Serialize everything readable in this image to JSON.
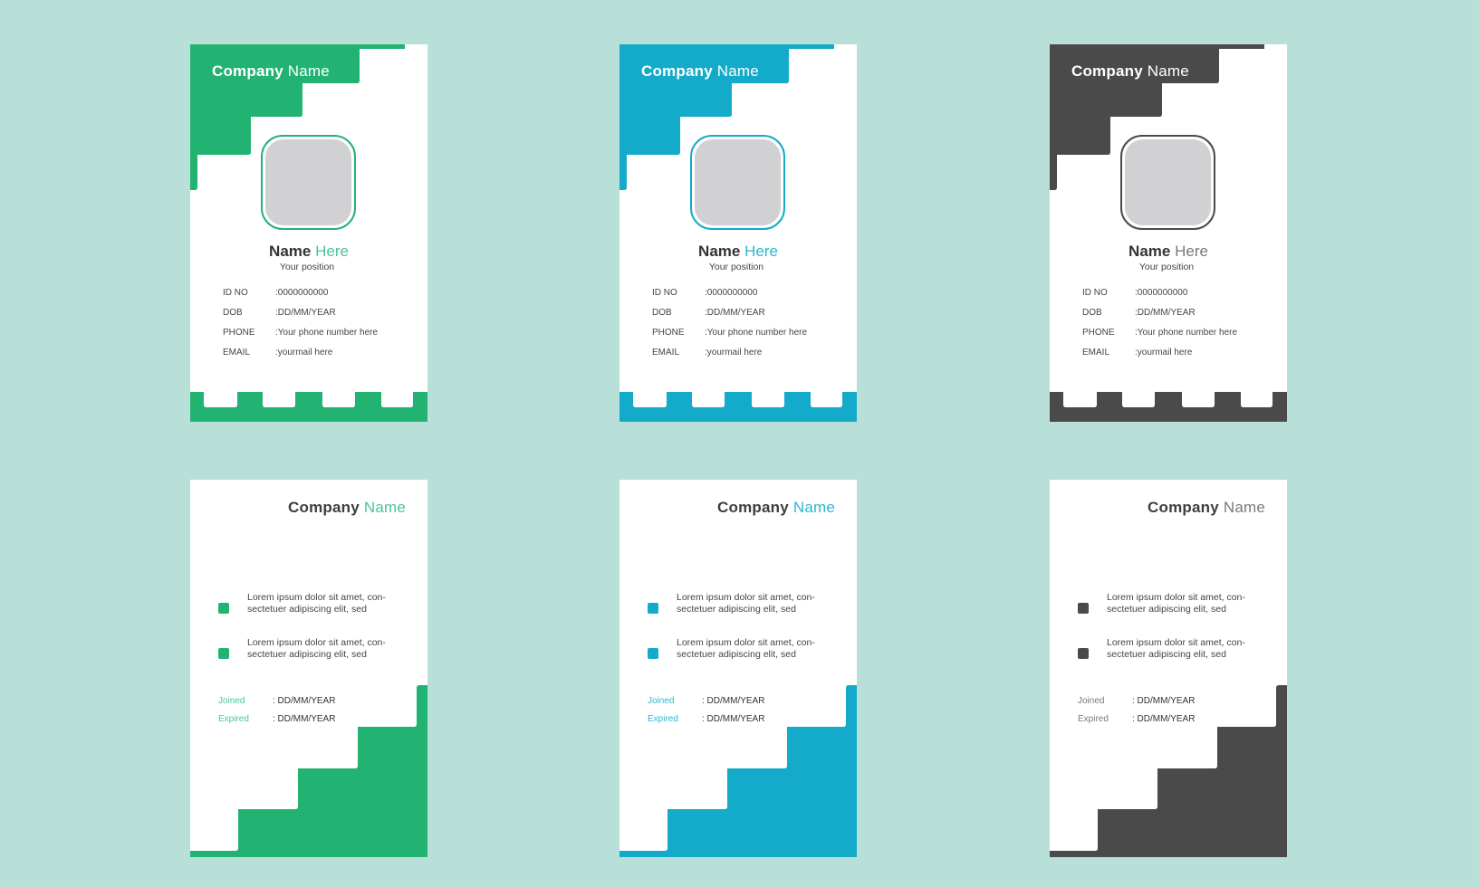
{
  "background": "#b8e0d8",
  "cards": [
    {
      "theme": "green",
      "accent": "#22b373",
      "accent_text": "#4cc39a",
      "front": {
        "company_bold": "Company",
        "company_light": "Name",
        "name_bold": "Name",
        "name_light": "Here",
        "position": "Your position",
        "fields": [
          {
            "label": "ID NO",
            "value": ":0000000000"
          },
          {
            "label": "DOB",
            "value": ":DD/MM/YEAR"
          },
          {
            "label": "PHONE",
            "value": ":Your phone number here"
          },
          {
            "label": "EMAIL",
            "value": ":yourmail here"
          }
        ]
      },
      "back": {
        "company_bold": "Company",
        "company_light": "Name",
        "bullets": [
          "Lorem ipsum dolor sit amet, con- sectetuer adipiscing elit, sed",
          "Lorem ipsum dolor sit amet, con- sectetuer adipiscing elit, sed"
        ],
        "dates": [
          {
            "label": "Joined",
            "value": ": DD/MM/YEAR"
          },
          {
            "label": "Expired",
            "value": ": DD/MM/YEAR"
          }
        ]
      }
    },
    {
      "theme": "blue",
      "accent": "#13abc9",
      "accent_text": "#2db6cf",
      "front": {
        "company_bold": "Company",
        "company_light": "Name",
        "name_bold": "Name",
        "name_light": "Here",
        "position": "Your position",
        "fields": [
          {
            "label": "ID NO",
            "value": ":0000000000"
          },
          {
            "label": "DOB",
            "value": ":DD/MM/YEAR"
          },
          {
            "label": "PHONE",
            "value": ":Your phone number here"
          },
          {
            "label": "EMAIL",
            "value": ":yourmail here"
          }
        ]
      },
      "back": {
        "company_bold": "Company",
        "company_light": "Name",
        "bullets": [
          "Lorem ipsum dolor sit amet, con- sectetuer adipiscing elit, sed",
          "Lorem ipsum dolor sit amet, con- sectetuer adipiscing elit, sed"
        ],
        "dates": [
          {
            "label": "Joined",
            "value": ": DD/MM/YEAR"
          },
          {
            "label": "Expired",
            "value": ": DD/MM/YEAR"
          }
        ]
      }
    },
    {
      "theme": "dark",
      "accent": "#4a4a4a",
      "accent_text": "#7a7a7a",
      "front": {
        "company_bold": "Company",
        "company_light": "Name",
        "name_bold": "Name",
        "name_light": "Here",
        "position": "Your position",
        "fields": [
          {
            "label": "ID NO",
            "value": ":0000000000"
          },
          {
            "label": "DOB",
            "value": ":DD/MM/YEAR"
          },
          {
            "label": "PHONE",
            "value": ":Your phone number here"
          },
          {
            "label": "EMAIL",
            "value": ":yourmail here"
          }
        ]
      },
      "back": {
        "company_bold": "Company",
        "company_light": "Name",
        "bullets": [
          "Lorem ipsum dolor sit amet, con- sectetuer adipiscing elit, sed",
          "Lorem ipsum dolor sit amet, con- sectetuer adipiscing elit, sed"
        ],
        "dates": [
          {
            "label": "Joined",
            "value": ": DD/MM/YEAR"
          },
          {
            "label": "Expired",
            "value": ": DD/MM/YEAR"
          }
        ]
      }
    }
  ]
}
